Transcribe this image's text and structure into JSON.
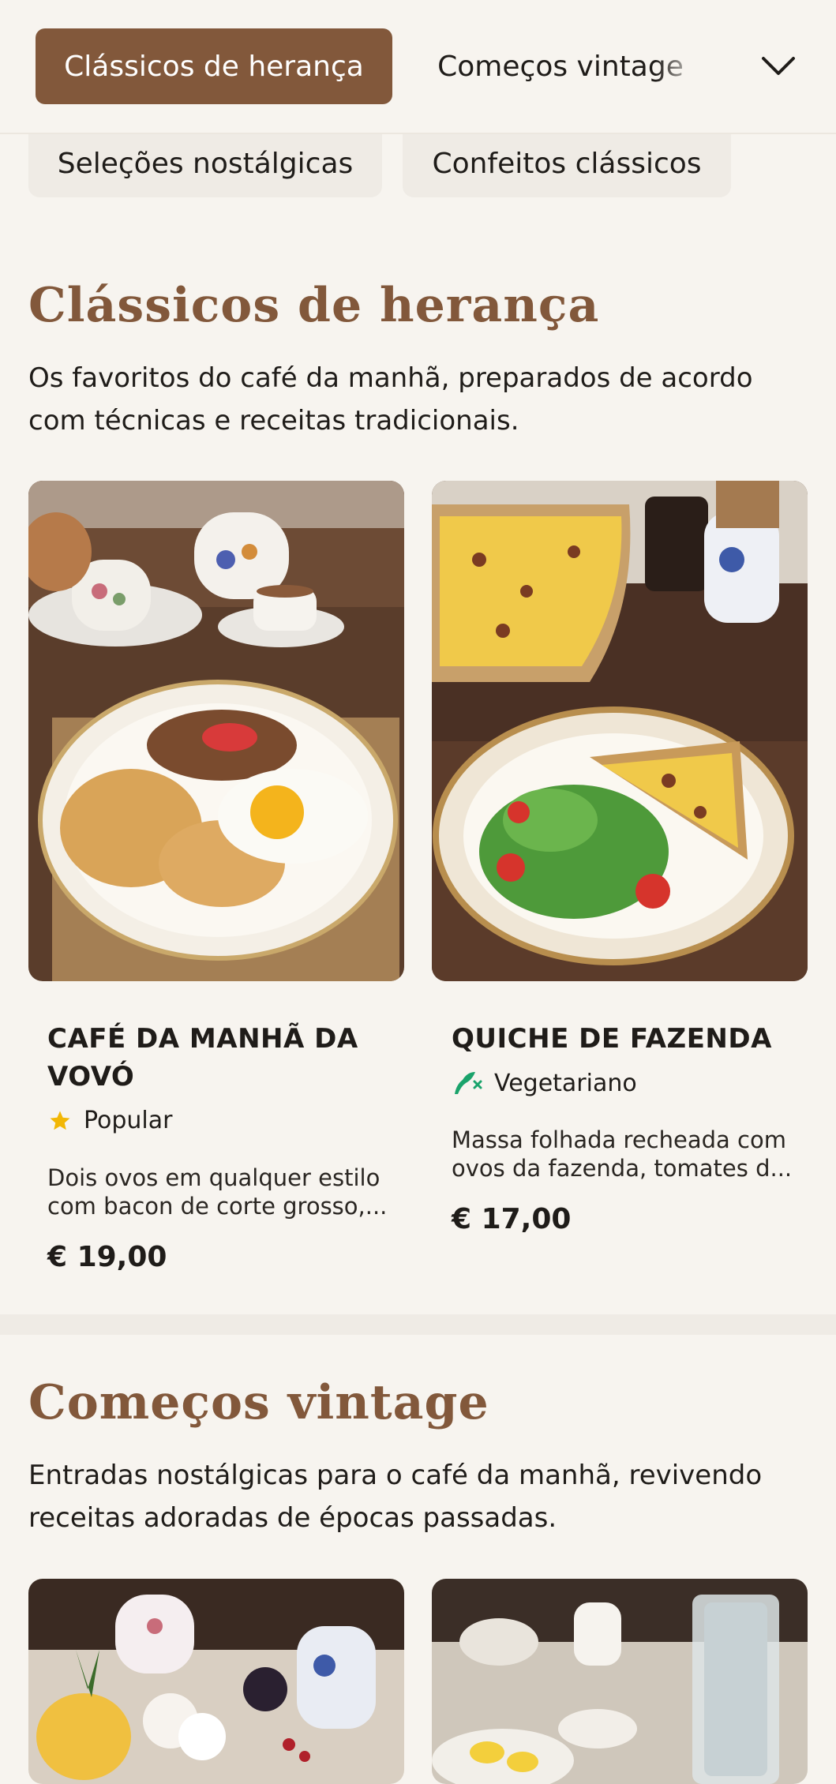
{
  "nav": {
    "active_tab": "Clássicos de herança",
    "next_tab": "Começos vintage",
    "row2": [
      "Seleções nostálgicas",
      "Confeitos clássicos"
    ]
  },
  "sections": [
    {
      "title": "Clássicos de herança",
      "description": "Os favoritos do café da manhã, preparados de acordo com técnicas e receitas tradicionais.",
      "items": [
        {
          "name": "CAFÉ DA MANHÃ DA VOVÓ",
          "tag": "Popular",
          "tag_icon": "star-icon",
          "description": "Dois ovos em qualquer estilo com bacon de corte grosso,...",
          "price": "€ 19,00"
        },
        {
          "name": "QUICHE DE FAZENDA",
          "tag": "Vegetariano",
          "tag_icon": "vegetarian-icon",
          "description": "Massa folhada recheada com ovos da fazenda, tomates d...",
          "price": "€ 17,00"
        }
      ]
    },
    {
      "title": "Começos vintage",
      "description": "Entradas nostálgicas para o café da manhã, revivendo receitas adoradas de épocas passadas."
    }
  ],
  "colors": {
    "accent": "#82583b",
    "background": "#f7f4ef",
    "star": "#f2b705",
    "vegetarian": "#1aa36b"
  }
}
